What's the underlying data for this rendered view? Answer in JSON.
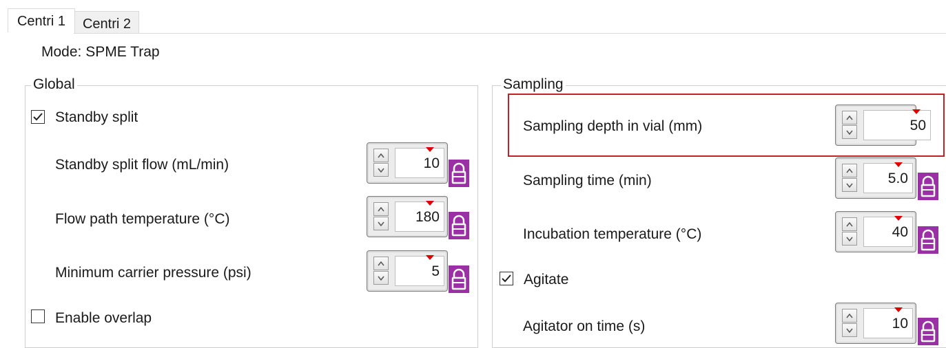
{
  "tabs": [
    {
      "label": "Centri 1",
      "active": true
    },
    {
      "label": "Centri 2",
      "active": false
    }
  ],
  "mode_text": "Mode: SPME Trap",
  "global": {
    "title": "Global",
    "standby_split": {
      "label": "Standby split",
      "checked": true
    },
    "rows": [
      {
        "label": "Standby split flow (mL/min)",
        "value": "10",
        "locked": true
      },
      {
        "label": "Flow path temperature (°C)",
        "value": "180",
        "locked": true
      },
      {
        "label": "Minimum carrier pressure (psi)",
        "value": "5",
        "locked": true
      }
    ],
    "enable_overlap": {
      "label": "Enable overlap",
      "checked": false
    }
  },
  "sampling": {
    "title": "Sampling",
    "rows": [
      {
        "label": "Sampling depth in vial (mm)",
        "value": "50",
        "locked": false,
        "highlighted": true
      },
      {
        "label": "Sampling time (min)",
        "value": "5.0",
        "locked": true
      },
      {
        "label": "Incubation temperature (°C)",
        "value": "40",
        "locked": true
      }
    ],
    "agitate": {
      "label": "Agitate",
      "checked": true
    },
    "agitator_row": {
      "label": "Agitator on time (s)",
      "value": "10",
      "locked": true
    }
  },
  "colors": {
    "lock": "#9b2fa6",
    "highlight": "#c31f27",
    "marker": "#e00000"
  },
  "icons": {
    "lock": "lock-icon",
    "check": "check-icon",
    "up": "arrow-up-icon",
    "down": "arrow-down-icon"
  }
}
